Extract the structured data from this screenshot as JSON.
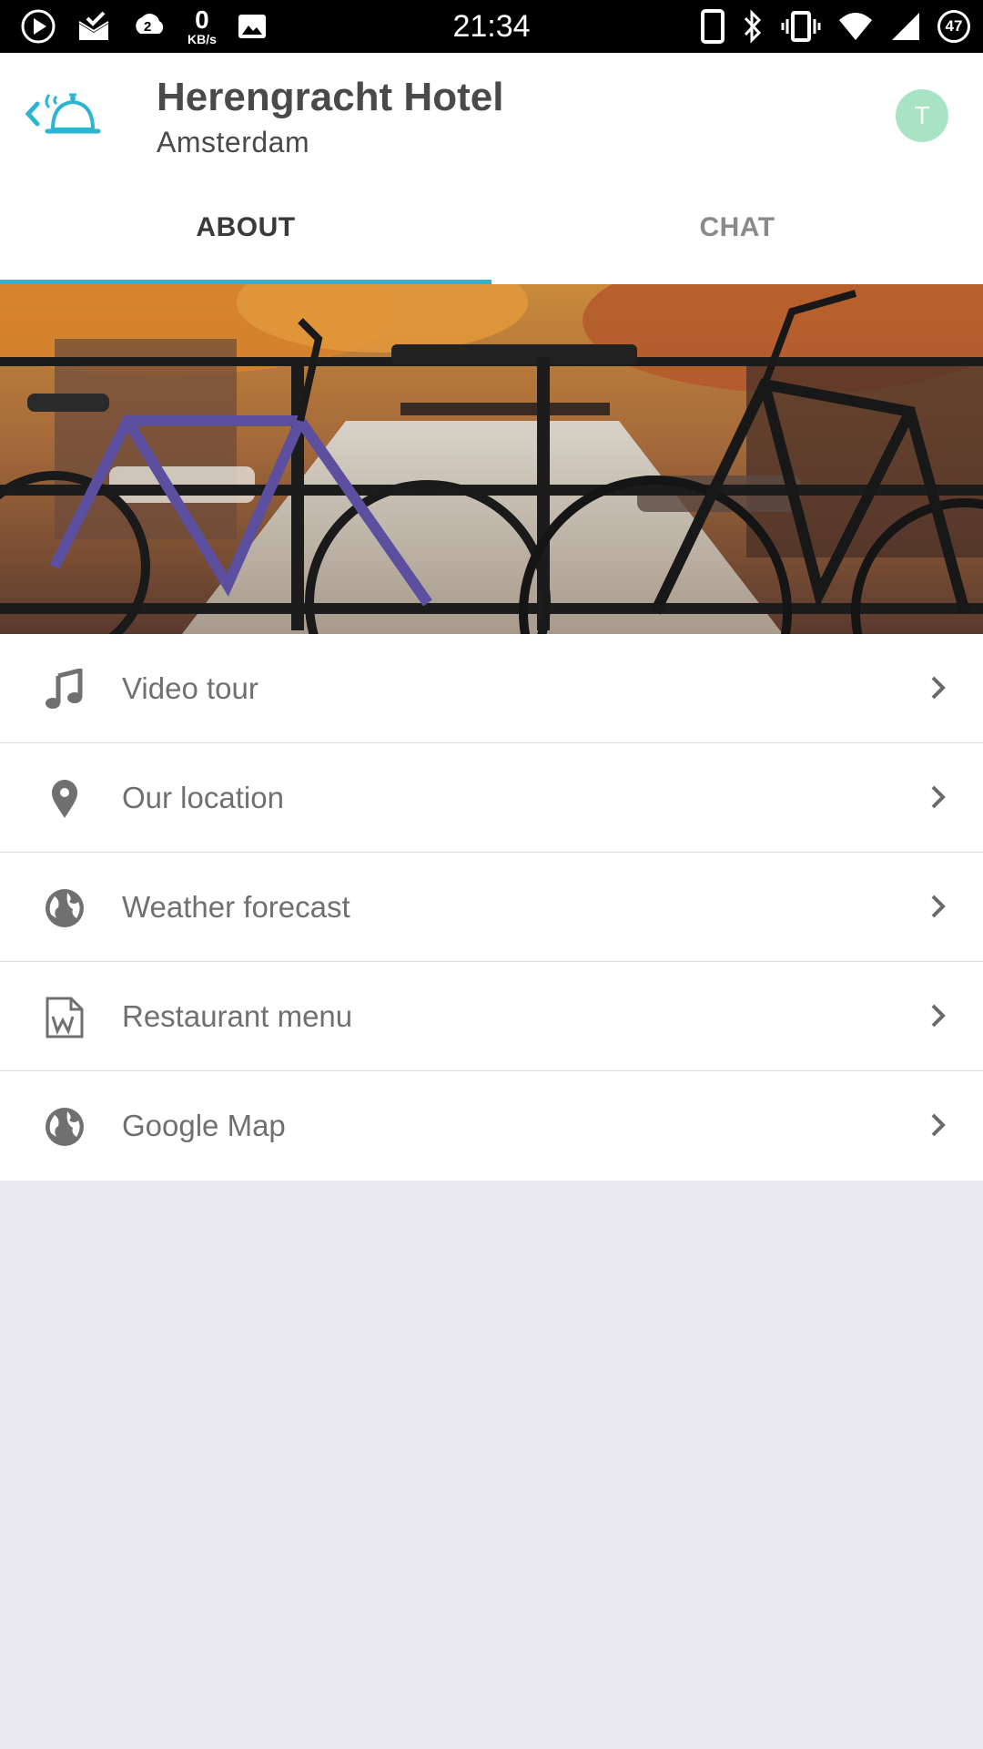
{
  "status_bar": {
    "time": "21:34",
    "net_speed_value": "0",
    "net_speed_unit": "KB/s",
    "notification_count": "2",
    "battery_level": "47"
  },
  "header": {
    "title": "Herengracht Hotel",
    "subtitle": "Amsterdam",
    "avatar_initial": "T"
  },
  "tabs": [
    {
      "label": "ABOUT",
      "active": true
    },
    {
      "label": "CHAT",
      "active": false
    }
  ],
  "hero": {
    "icon": "canal-bicycles-photo"
  },
  "menu": {
    "items": [
      {
        "label": "Video tour",
        "icon": "music-note-icon"
      },
      {
        "label": "Our location",
        "icon": "location-pin-icon"
      },
      {
        "label": "Weather forecast",
        "icon": "globe-icon"
      },
      {
        "label": "Restaurant menu",
        "icon": "word-document-icon"
      },
      {
        "label": "Google Map",
        "icon": "globe-icon"
      }
    ]
  },
  "colors": {
    "accent": "#2bb5d3",
    "avatar_bg": "#a8e4c4",
    "background": "#e9e8ee"
  }
}
